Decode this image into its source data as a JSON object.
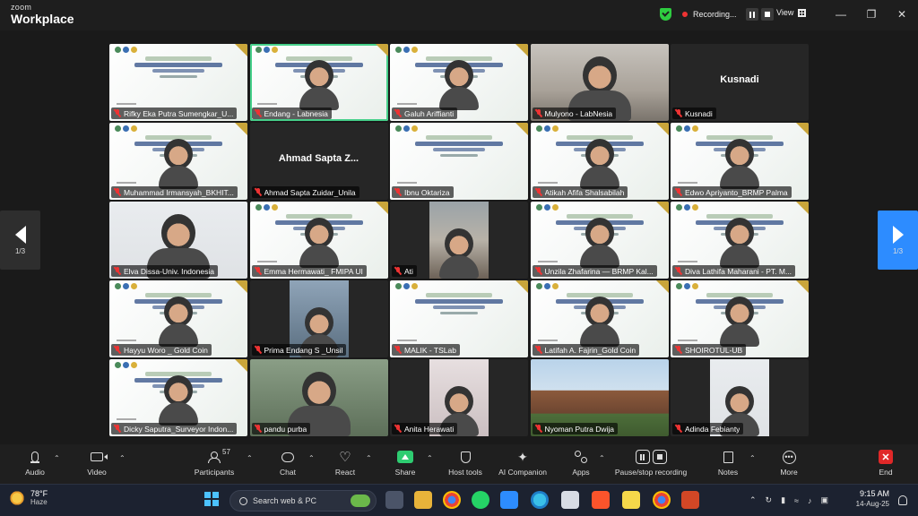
{
  "titlebar": {
    "logo_top": "zoom",
    "logo_bottom": "Workplace",
    "recording_label": "Recording...",
    "view_label": "View"
  },
  "pagination": {
    "left_label": "1/3",
    "right_label": "1/3"
  },
  "tiles": [
    {
      "name": "Rifky Eka Putra Sumengkar_U...",
      "type": "slide"
    },
    {
      "name": "Endang - Labnesia",
      "type": "slide-person",
      "active": true
    },
    {
      "name": "Galuh Ariffianti",
      "type": "slide-person"
    },
    {
      "name": "Mulyono - LabNesia",
      "type": "photo",
      "bg": "office"
    },
    {
      "name": "Kusnadi",
      "type": "text-only",
      "big": "Kusnadi"
    },
    {
      "name": "Muhammad Irmansyah_BKHIT...",
      "type": "slide-person"
    },
    {
      "name": "Ahmad Sapta Zuidar_Unila",
      "type": "text-only",
      "big": "Ahmad Sapta Z..."
    },
    {
      "name": "Ibnu Oktariza",
      "type": "slide"
    },
    {
      "name": "Atikah Afifa Shalsabilah",
      "type": "slide-person"
    },
    {
      "name": "Edwo Apriyanto_BRMP Palma",
      "type": "slide-person"
    },
    {
      "name": "Elva Dissa-Univ. Indonesia",
      "type": "photo",
      "bg": "white"
    },
    {
      "name": "Emma Hermawati_ FMIPA UI",
      "type": "slide-person"
    },
    {
      "name": "Ati",
      "type": "inset",
      "bg": "room"
    },
    {
      "name": "Unzila Zhafarina — BRMP Kal...",
      "type": "slide-person"
    },
    {
      "name": "Diva Lathifa Maharani - PT. M...",
      "type": "slide-person"
    },
    {
      "name": "Hayyu Woro _ Gold Coin",
      "type": "slide-person"
    },
    {
      "name": "Prima Endang S _Unsil",
      "type": "inset",
      "bg": "blue"
    },
    {
      "name": "MALIK - TSLab",
      "type": "slide"
    },
    {
      "name": "Latifah A. Fajrin_Gold Coin",
      "type": "slide-person"
    },
    {
      "name": "SHOIROTUL-UB",
      "type": "slide-person"
    },
    {
      "name": "Dicky Saputra_Surveyor Indon...",
      "type": "slide-person"
    },
    {
      "name": "pandu purba",
      "type": "photo",
      "bg": "green"
    },
    {
      "name": "Anita Herawati",
      "type": "inset",
      "bg": "pink"
    },
    {
      "name": "Nyoman Putra Dwija",
      "type": "photo",
      "bg": "bldg"
    },
    {
      "name": "Adinda Febianty",
      "type": "inset",
      "bg": "white"
    }
  ],
  "toolbar": {
    "audio": "Audio",
    "video": "Video",
    "participants": "Participants",
    "participant_count": "57",
    "chat": "Chat",
    "react": "React",
    "share": "Share",
    "host_tools": "Host tools",
    "ai_companion": "AI Companion",
    "apps": "Apps",
    "pause_recording": "Pause/stop recording",
    "notes": "Notes",
    "more": "More",
    "end": "End"
  },
  "taskbar": {
    "temperature": "78°F",
    "weather": "Haze",
    "search_placeholder": "Search web & PC",
    "time": "9:15 AM",
    "date": "14-Aug-25"
  }
}
